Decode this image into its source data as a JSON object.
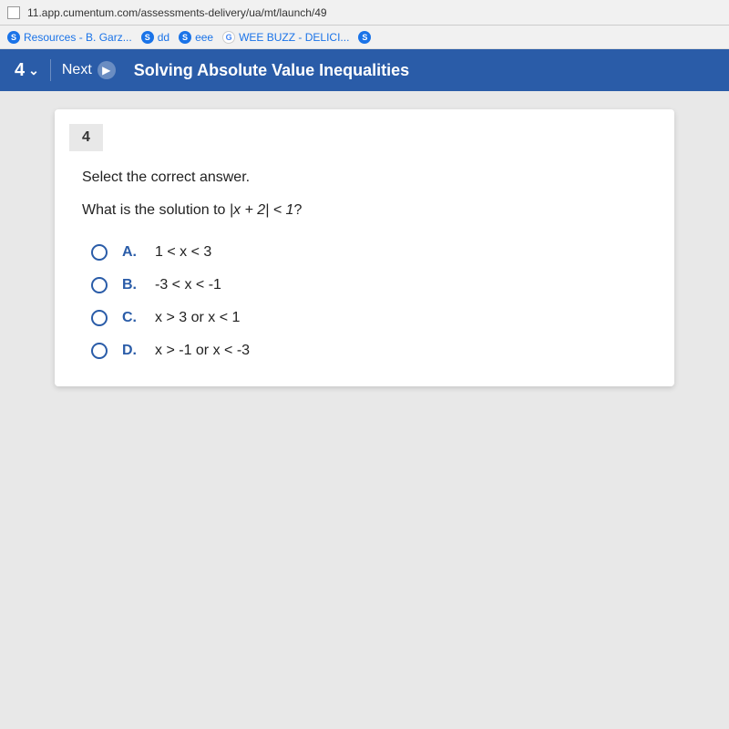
{
  "browser": {
    "url": "11.app.cumentum.com/assessments-delivery/ua/mt/launch/49",
    "checkbox_visible": true
  },
  "bookmarks": [
    {
      "label": "Resources - B. Garz...",
      "type": "blue"
    },
    {
      "label": "dd",
      "type": "blue"
    },
    {
      "label": "eee",
      "type": "blue"
    },
    {
      "label": "WEE BUZZ - DELICI...",
      "type": "google"
    },
    {
      "label": "",
      "type": "blue"
    }
  ],
  "toolbar": {
    "question_number": "4",
    "next_label": "Next",
    "title": "Solving Absolute Value Inequalities"
  },
  "question": {
    "number": "4",
    "instruction": "Select the correct answer.",
    "text_prefix": "What is the solution to ",
    "math_expr": "|x + 2| < 1",
    "text_suffix": "?",
    "options": [
      {
        "id": "A",
        "text": "1 < x < 3"
      },
      {
        "id": "B",
        "text": "-3 < x < -1"
      },
      {
        "id": "C",
        "text": "x > 3 or x < 1"
      },
      {
        "id": "D",
        "text": "x > -1 or x < -3"
      }
    ]
  }
}
